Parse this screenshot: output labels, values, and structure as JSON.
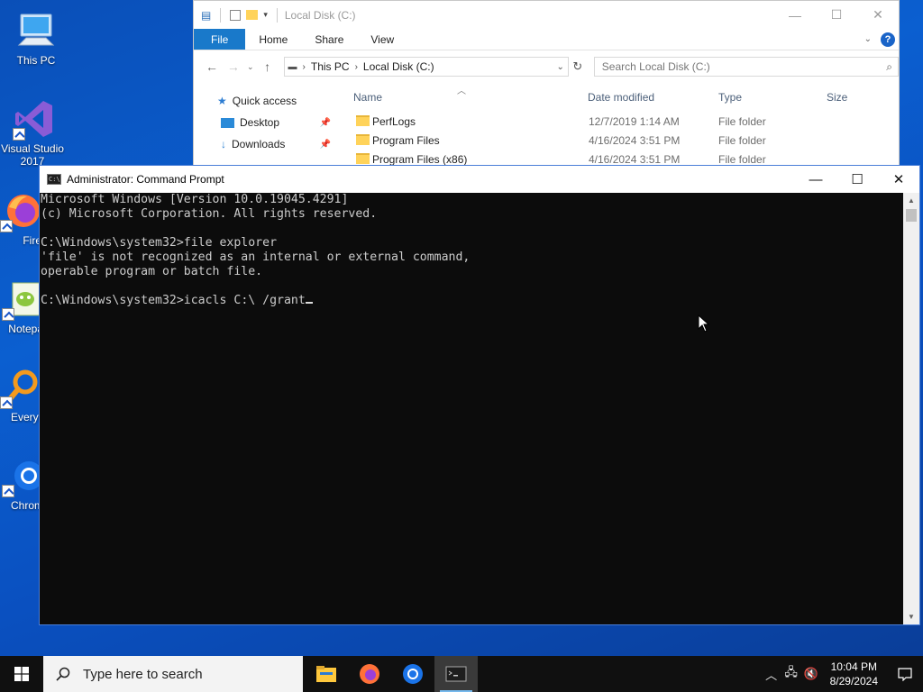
{
  "desktop": {
    "icons": [
      {
        "label": "This PC",
        "icon": "computer-icon"
      },
      {
        "label": "Visual Studio 2017",
        "icon": "visual-studio-icon"
      },
      {
        "label": "Fire",
        "icon": "firefox-icon"
      },
      {
        "label": "Notepa",
        "icon": "notepad-plus-icon"
      },
      {
        "label": "Everyt",
        "icon": "everything-search-icon"
      },
      {
        "label": "Chrom",
        "icon": "chrome-icon"
      }
    ]
  },
  "explorer": {
    "title": "Local Disk (C:)",
    "ribbon": {
      "file": "File",
      "home": "Home",
      "share": "Share",
      "view": "View"
    },
    "address": {
      "this_pc": "This PC",
      "drive": "Local Disk (C:)"
    },
    "search_placeholder": "Search Local Disk (C:)",
    "sidebar": [
      {
        "label": "Quick access",
        "icon": "star-icon"
      },
      {
        "label": "Desktop",
        "icon": "desktop-folder-icon"
      },
      {
        "label": "Downloads",
        "icon": "download-arrow-icon"
      }
    ],
    "columns": {
      "name": "Name",
      "date": "Date modified",
      "type": "Type",
      "size": "Size"
    },
    "files": [
      {
        "name": "PerfLogs",
        "date": "12/7/2019 1:14 AM",
        "type": "File folder"
      },
      {
        "name": "Program Files",
        "date": "4/16/2024 3:51 PM",
        "type": "File folder"
      },
      {
        "name": "Program Files (x86)",
        "date": "4/16/2024 3:51 PM",
        "type": "File folder"
      }
    ]
  },
  "cmd": {
    "title": "Administrator: Command Prompt",
    "icon_text": "C:\\",
    "lines": [
      "Microsoft Windows [Version 10.0.19045.4291]",
      "(c) Microsoft Corporation. All rights reserved.",
      "",
      "C:\\Windows\\system32>file explorer",
      "'file' is not recognized as an internal or external command,",
      "operable program or batch file.",
      ""
    ],
    "prompt": "C:\\Windows\\system32>",
    "current_input": "icacls C:\\ /grant"
  },
  "taskbar": {
    "search_placeholder": "Type here to search",
    "apps": [
      "file-explorer-icon",
      "firefox-icon",
      "chrome-icon",
      "command-prompt-icon"
    ],
    "time": "10:04 PM",
    "date": "8/29/2024"
  },
  "colors": {
    "accent": "#1979ca",
    "desktop": "#0b5fd0",
    "console_bg": "#0c0c0c",
    "console_fg": "#cccccc"
  }
}
